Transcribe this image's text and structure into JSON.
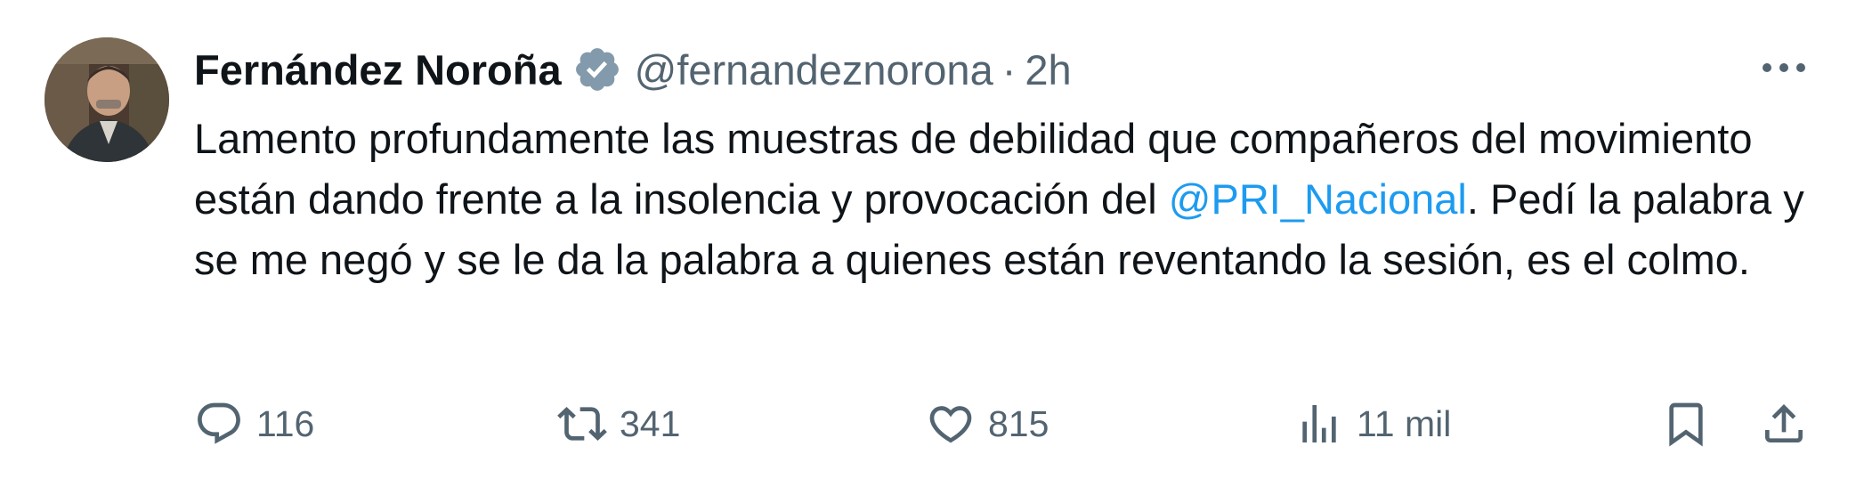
{
  "tweet": {
    "author_name": "Fernández Noroña",
    "handle": "@fernandeznorona",
    "separator": "·",
    "time": "2h",
    "text_before": "Lamento profundamente las muestras de debilidad que compañeros del movimiento están dando frente a la insolencia y provocación del ",
    "mention": "@PRI_Nacional",
    "text_after": ". Pedí la palabra y se me negó y se le da la palabra a quienes están reventando la sesión, es el colmo."
  },
  "actions": {
    "replies": "116",
    "retweets": "341",
    "likes": "815",
    "views": "11 mil"
  },
  "icons": {
    "verified": "verified-badge-icon",
    "more": "more-icon",
    "reply": "reply-icon",
    "retweet": "retweet-icon",
    "like": "heart-icon",
    "views": "analytics-icon",
    "bookmark": "bookmark-icon",
    "share": "share-icon"
  },
  "colors": {
    "text": "#0f1419",
    "secondary": "#536471",
    "link": "#1d9bf0",
    "verified_badge": "#829aab"
  }
}
